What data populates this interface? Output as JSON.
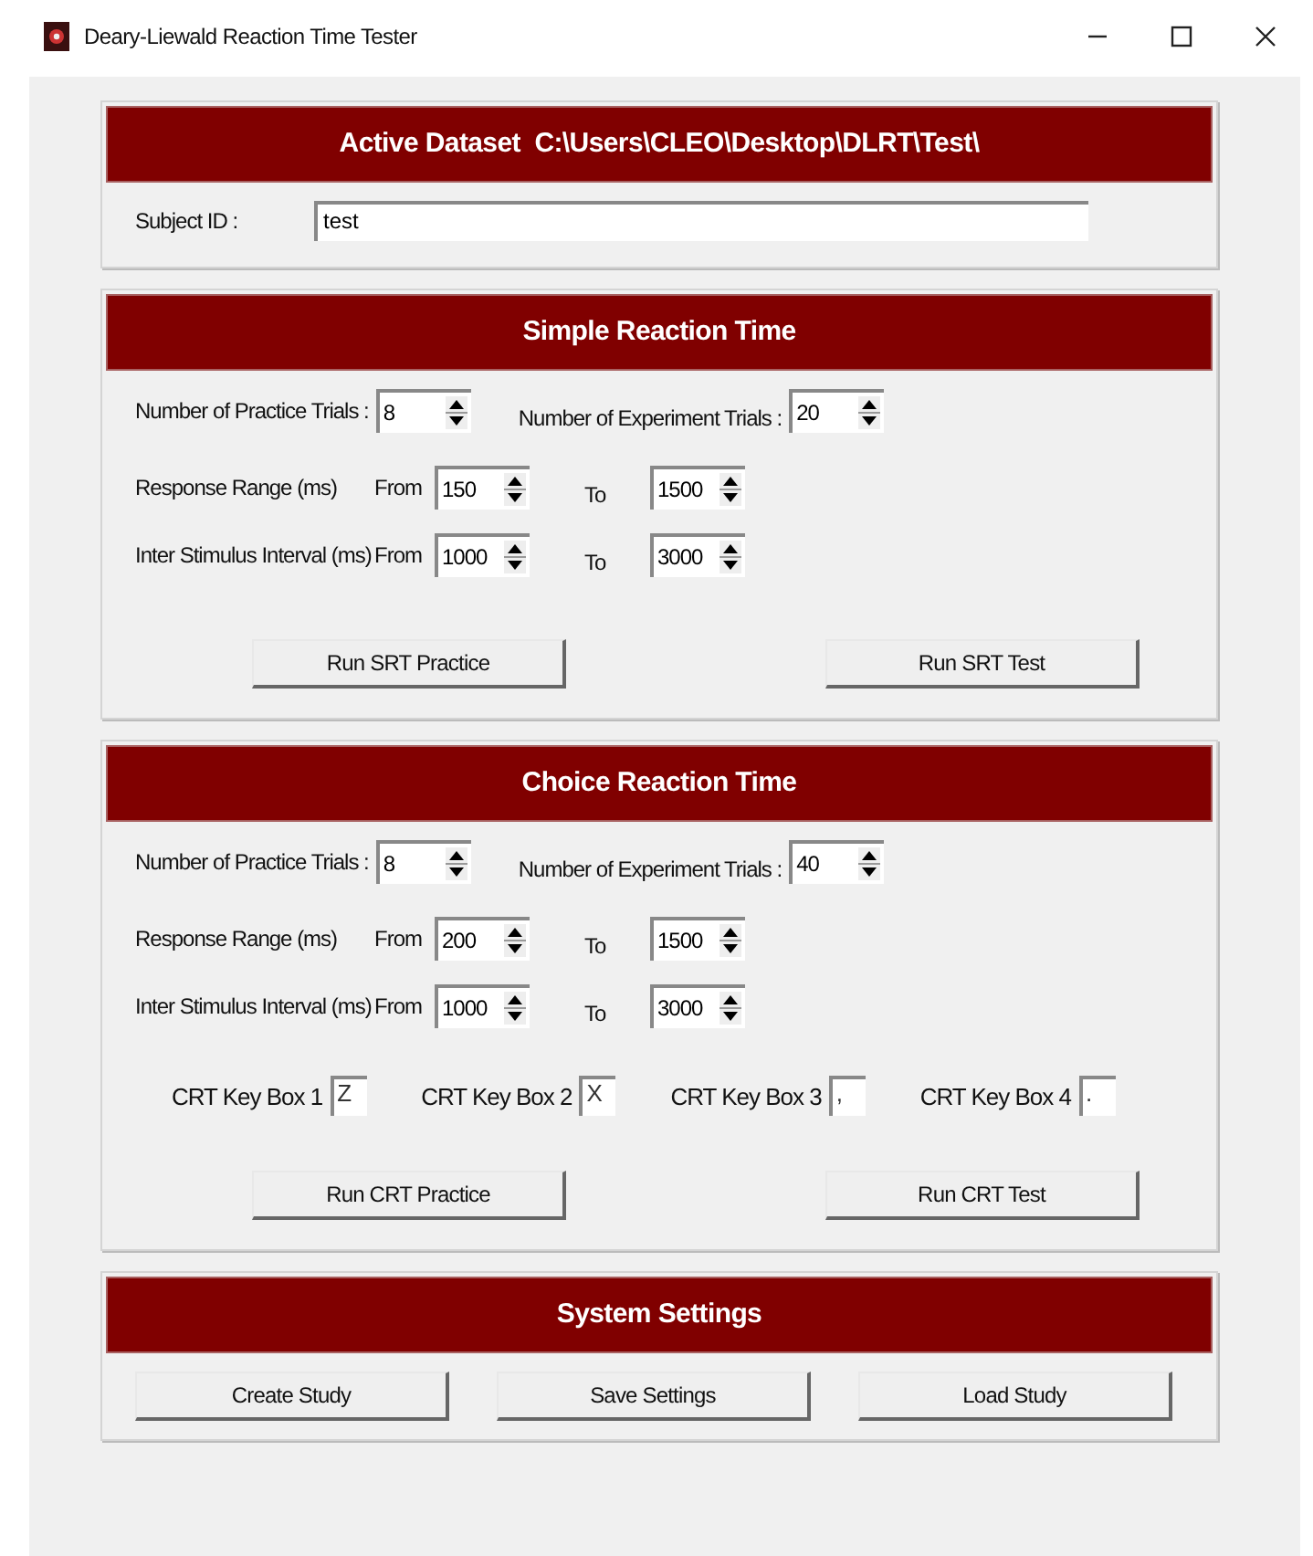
{
  "window": {
    "title": "Deary-Liewald Reaction Time Tester"
  },
  "dataset_panel": {
    "title": "Active Dataset  C:\\Users\\CLEO\\Desktop\\DLRT\\Test\\",
    "subject_label": "Subject ID :",
    "subject_value": "test"
  },
  "sections": [
    {
      "title": "Simple Reaction Time",
      "practice_label": "Number of Practice Trials :",
      "practice_value": "8",
      "experiment_label": "Number of Experiment Trials :",
      "experiment_value": "20",
      "ranges": [
        {
          "label": "Response Range (ms)",
          "from_label": "From",
          "from_value": "150",
          "to_label": "To",
          "to_value": "1500"
        },
        {
          "label": "Inter Stimulus Interval (ms)",
          "from_label": "From",
          "from_value": "1000",
          "to_label": "To",
          "to_value": "3000"
        }
      ],
      "buttons": [
        "Run SRT Practice",
        "Run SRT Test"
      ]
    },
    {
      "title": "Choice Reaction Time",
      "practice_label": "Number of Practice Trials :",
      "practice_value": "8",
      "experiment_label": "Number of Experiment Trials :",
      "experiment_value": "40",
      "ranges": [
        {
          "label": "Response Range (ms)",
          "from_label": "From",
          "from_value": "200",
          "to_label": "To",
          "to_value": "1500"
        },
        {
          "label": "Inter Stimulus Interval (ms)",
          "from_label": "From",
          "from_value": "1000",
          "to_label": "To",
          "to_value": "3000"
        }
      ],
      "key_boxes": [
        {
          "label": "CRT Key Box 1",
          "value": "Z"
        },
        {
          "label": "CRT Key Box 2",
          "value": "X"
        },
        {
          "label": "CRT Key Box 3",
          "value": ","
        },
        {
          "label": "CRT Key Box 4",
          "value": "."
        }
      ],
      "buttons": [
        "Run CRT Practice",
        "Run CRT Test"
      ]
    }
  ],
  "settings": {
    "title": "System Settings",
    "buttons": [
      "Create Study",
      "Save Settings",
      "Load Study"
    ]
  }
}
